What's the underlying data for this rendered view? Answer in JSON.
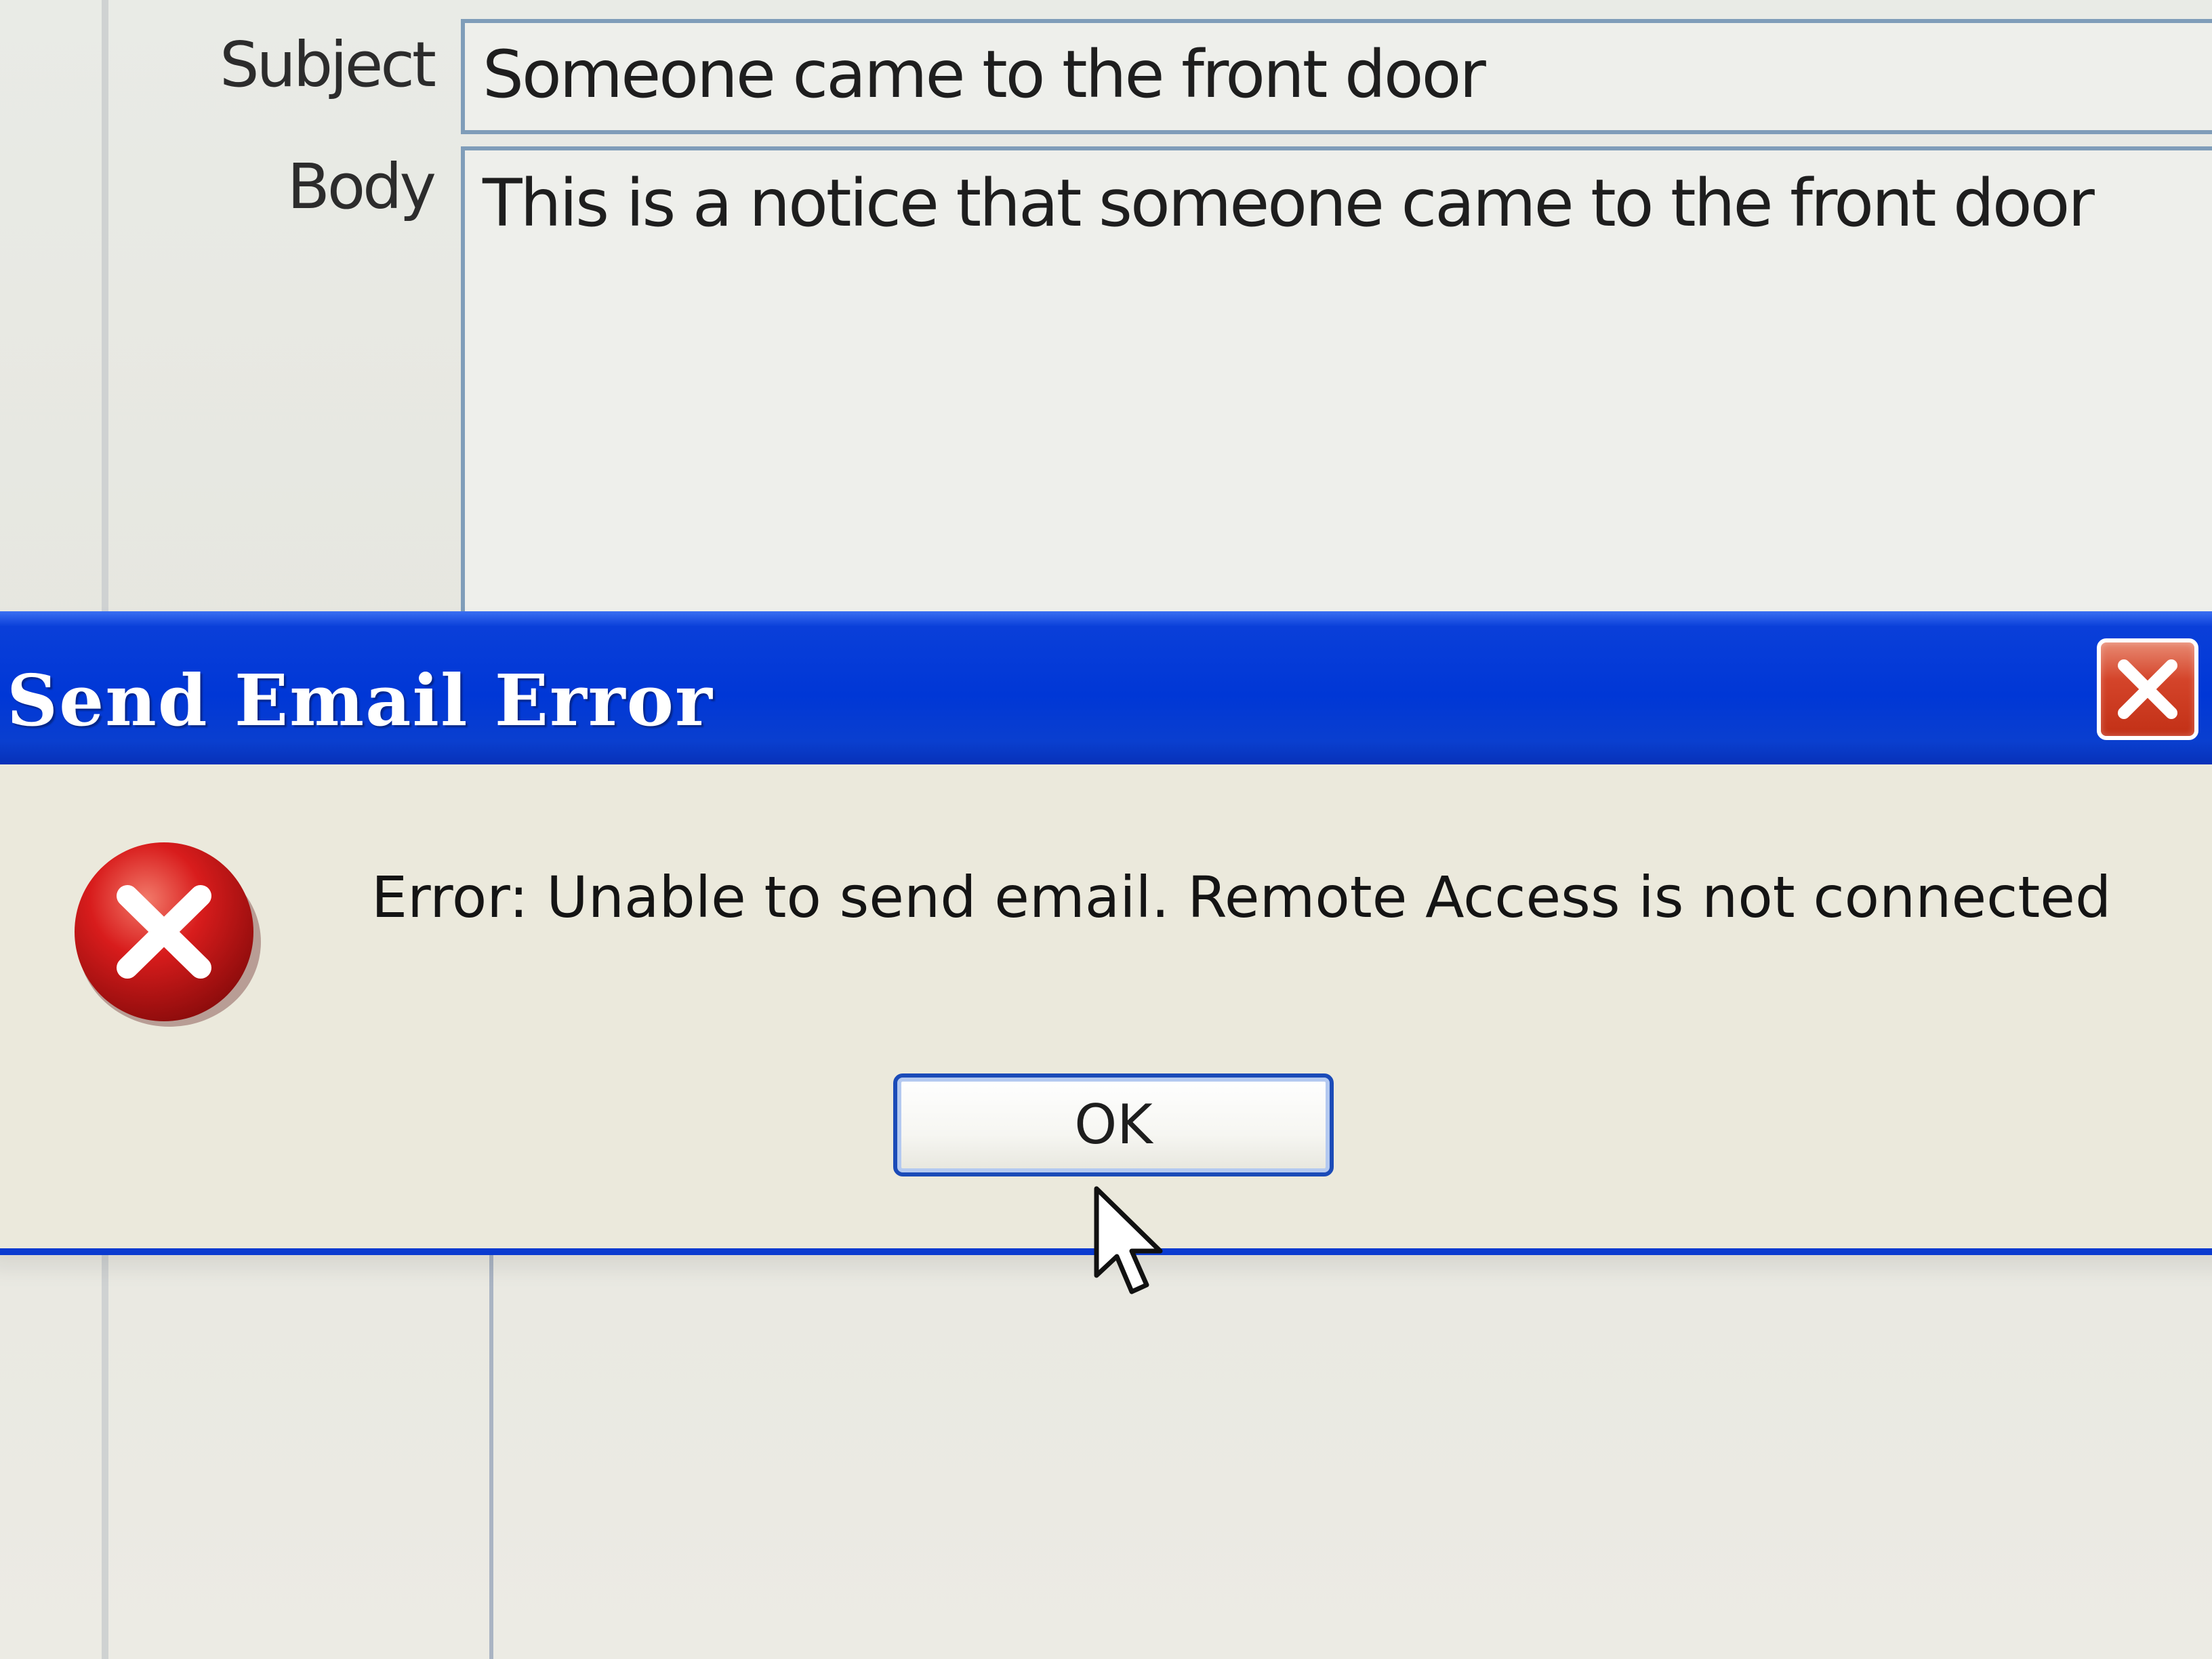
{
  "email_form": {
    "subject_label": "Subject",
    "subject_value": "Someone came to the front door",
    "body_label": "Body",
    "body_value": "This is a notice that someone came to the front door"
  },
  "dialog": {
    "title": "Send Email Error",
    "message": "Error: Unable to send email. Remote Access is not connected",
    "ok_label": "OK",
    "icons": {
      "close": "close-icon",
      "error": "error-icon",
      "cursor": "mouse-pointer-icon"
    }
  },
  "colors": {
    "titlebar": "#0037d6",
    "close_button": "#d4442a",
    "dialog_background": "#ebe9dc",
    "error_icon": "#d81c1c"
  }
}
